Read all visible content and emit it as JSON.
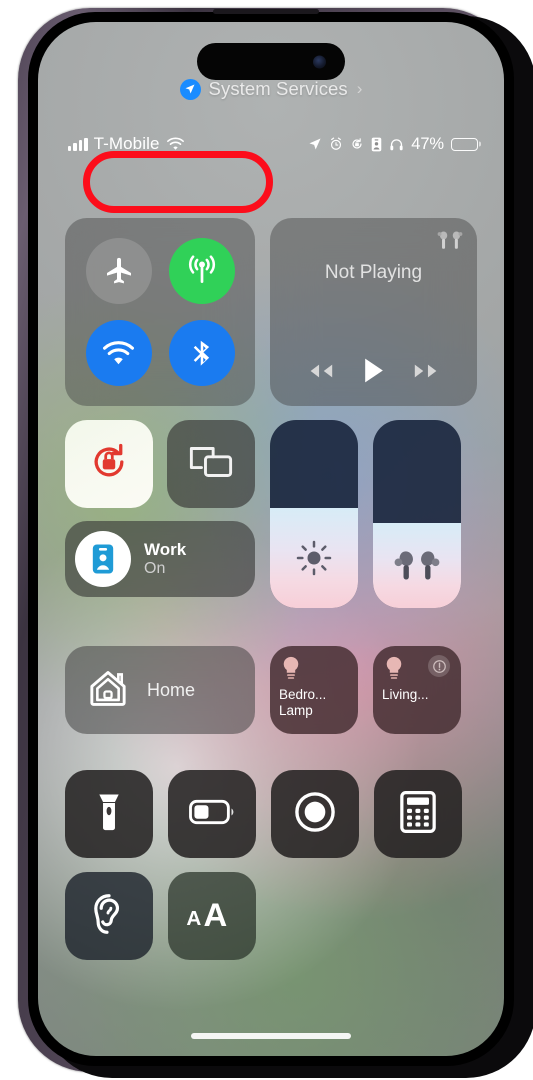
{
  "header": {
    "location_icon": "location-arrow-icon",
    "title": "System Services",
    "chevron": "›"
  },
  "status_bar": {
    "signal_icon": "cellular-bars-icon",
    "carrier": "T-Mobile",
    "wifi_icon": "wifi-icon",
    "right_icons": [
      "location-arrow-icon",
      "alarm-clock-icon",
      "rotation-lock-icon",
      "id-card-icon",
      "headphones-icon"
    ],
    "battery_percent": "47%",
    "battery_level": 47,
    "battery_icon": "battery-icon"
  },
  "highlight": {
    "color": "#fc0d1b",
    "target": "carrier-wifi-status"
  },
  "control_center": {
    "connectivity": {
      "airplane": {
        "icon": "airplane-icon",
        "label": "Airplane Mode",
        "state": "off",
        "color": "#969696"
      },
      "cellular": {
        "icon": "cellular-antenna-icon",
        "label": "Cellular Data",
        "state": "on",
        "color": "#30d158"
      },
      "wifi": {
        "icon": "wifi-icon",
        "label": "Wi-Fi",
        "state": "on",
        "color": "#1a7bf0"
      },
      "bluetooth": {
        "icon": "bluetooth-icon",
        "label": "Bluetooth",
        "state": "on",
        "color": "#1a7bf0"
      }
    },
    "media": {
      "title": "Not Playing",
      "route_icon": "airpods-icon",
      "rewind_icon": "rewind-icon",
      "play_icon": "play-icon",
      "forward_icon": "fast-forward-icon"
    },
    "rotation_lock": {
      "icon": "rotation-lock-icon",
      "label": "Portrait Orientation Lock",
      "state": "on"
    },
    "screen_mirroring": {
      "icon": "screen-mirroring-icon",
      "label": "Screen Mirroring",
      "state": "off"
    },
    "focus": {
      "icon": "id-card-icon",
      "title": "Work",
      "subtitle": "On"
    },
    "brightness": {
      "icon": "brightness-sun-icon",
      "label": "Brightness",
      "level": 53
    },
    "volume": {
      "icon": "airpods-icon",
      "label": "Volume",
      "level": 45
    },
    "home": {
      "icon": "home-icon",
      "label": "Home"
    },
    "lights": [
      {
        "icon": "lightbulb-icon",
        "name": "Bedro...\nLamp",
        "line1": "Bedro...",
        "line2": "Lamp",
        "warning": false
      },
      {
        "icon": "lightbulb-icon",
        "name": "Living...",
        "line1": "Living...",
        "line2": "",
        "warning": true,
        "warning_icon": "exclamation-icon"
      }
    ],
    "utilities": [
      {
        "icon": "flashlight-icon",
        "label": "Flashlight"
      },
      {
        "icon": "low-power-battery-icon",
        "label": "Low Power Mode"
      },
      {
        "icon": "screen-record-icon",
        "label": "Screen Recording"
      },
      {
        "icon": "calculator-icon",
        "label": "Calculator"
      }
    ],
    "accessibility": [
      {
        "icon": "hearing-ear-icon",
        "label": "Hearing"
      },
      {
        "icon": "text-size-icon",
        "label": "Text Size",
        "glyph": "AA"
      }
    ]
  },
  "home_indicator": "home-indicator"
}
